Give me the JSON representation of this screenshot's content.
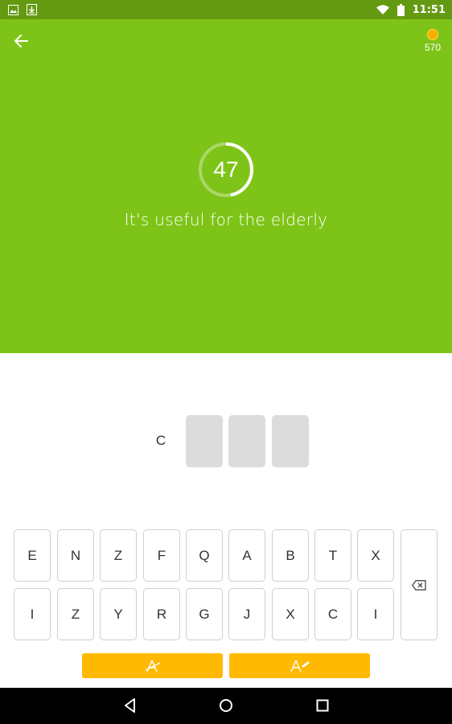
{
  "status_bar": {
    "time": "11:51",
    "icons": [
      "image-icon",
      "download-icon",
      "wifi-icon",
      "battery-icon"
    ]
  },
  "header": {
    "back_icon": "arrow-left-icon",
    "coins": "570"
  },
  "timer": {
    "value": "47",
    "progress": 0.47
  },
  "question": {
    "clue": "It's useful for the elderly"
  },
  "answer": {
    "revealed_letter": "C",
    "empty_slots": 3
  },
  "keyboard": {
    "row1": [
      "E",
      "N",
      "Z",
      "F",
      "Q",
      "A",
      "B",
      "T",
      "X"
    ],
    "row2": [
      "I",
      "Z",
      "Y",
      "R",
      "G",
      "J",
      "X",
      "C",
      "I"
    ],
    "backspace_icon": "backspace-icon"
  },
  "hints": {
    "remove_letters_icon": "remove-letters-icon",
    "reveal_letter_icon": "reveal-letter-icon"
  },
  "nav_bar": {
    "icons": [
      "back-triangle-icon",
      "home-circle-icon",
      "recents-square-icon"
    ]
  },
  "colors": {
    "primary_green": "#7ec418",
    "status_green": "#649a12",
    "hint_yellow": "#ffb900",
    "coin": "#f7b000"
  }
}
